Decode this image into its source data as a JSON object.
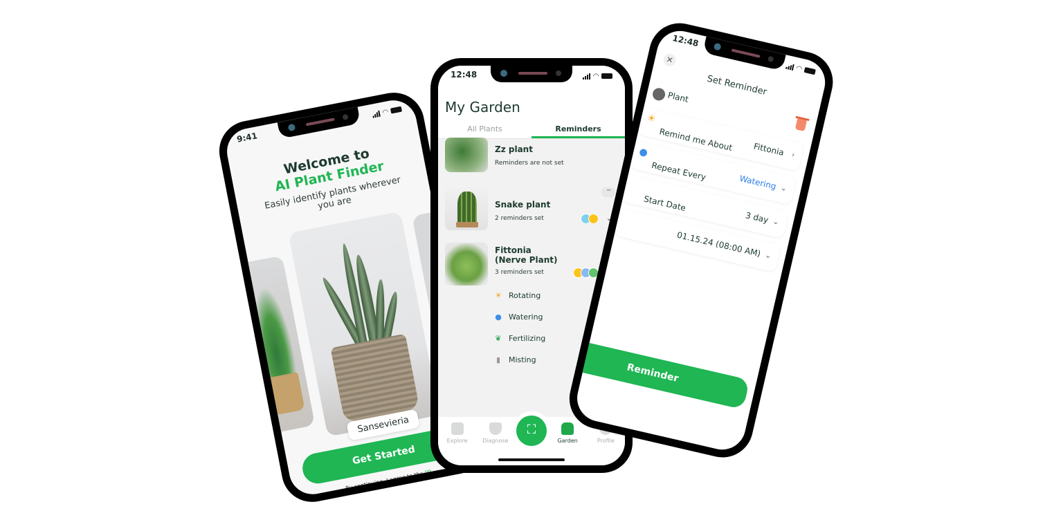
{
  "phone1": {
    "status_time": "9:41",
    "welcome_line": "Welcome to",
    "brand": "AI Plant Finder",
    "tagline": "Easily identify plants wherever you are",
    "carousel_label": "Sansevieria",
    "cta": "Get Started",
    "terms_prefix": "By continuing, I agree to the",
    "terms_link": "PP"
  },
  "phone2": {
    "status_time": "12:48",
    "title": "My Garden",
    "tabs": [
      "All Plants",
      "Reminders"
    ],
    "active_tab": "Reminders",
    "plants": [
      {
        "name": "Zz plant",
        "status": "Reminders are not set"
      },
      {
        "name": "Snake plant",
        "status": "2 reminders set"
      },
      {
        "name": "Fittonia (Nerve Plant)",
        "name_line1": "Fittonia",
        "name_line2": "(Nerve Plant)",
        "status": "3 reminders set"
      }
    ],
    "reminders": [
      {
        "label": "Rotating",
        "icon": "sun-icon",
        "done": true
      },
      {
        "label": "Watering",
        "icon": "watering-can-icon",
        "done": true
      },
      {
        "label": "Fertilizing",
        "icon": "leaf-icon",
        "done": true
      },
      {
        "label": "Misting",
        "icon": "spray-bottle-icon",
        "done": false
      }
    ],
    "nav": [
      "Explore",
      "Diagnose",
      "Garden",
      "Profile"
    ],
    "active_nav": "Garden",
    "colors": {
      "accent": "#1fb653",
      "text": "#1d3a2e"
    }
  },
  "phone3": {
    "status_time": "12:48",
    "title": "Set Reminder",
    "fields": [
      {
        "label": "Plant",
        "value": "Fittonia"
      },
      {
        "label": "Remind me About",
        "value": "Watering"
      },
      {
        "label": "Repeat Every",
        "value": "3 day"
      },
      {
        "label": "Start Date",
        "value": "01.15.24 (08:00 AM)"
      }
    ],
    "cta": "Reminder",
    "colors": {
      "delete": "#f38b6b",
      "link": "#2b7de9"
    }
  }
}
